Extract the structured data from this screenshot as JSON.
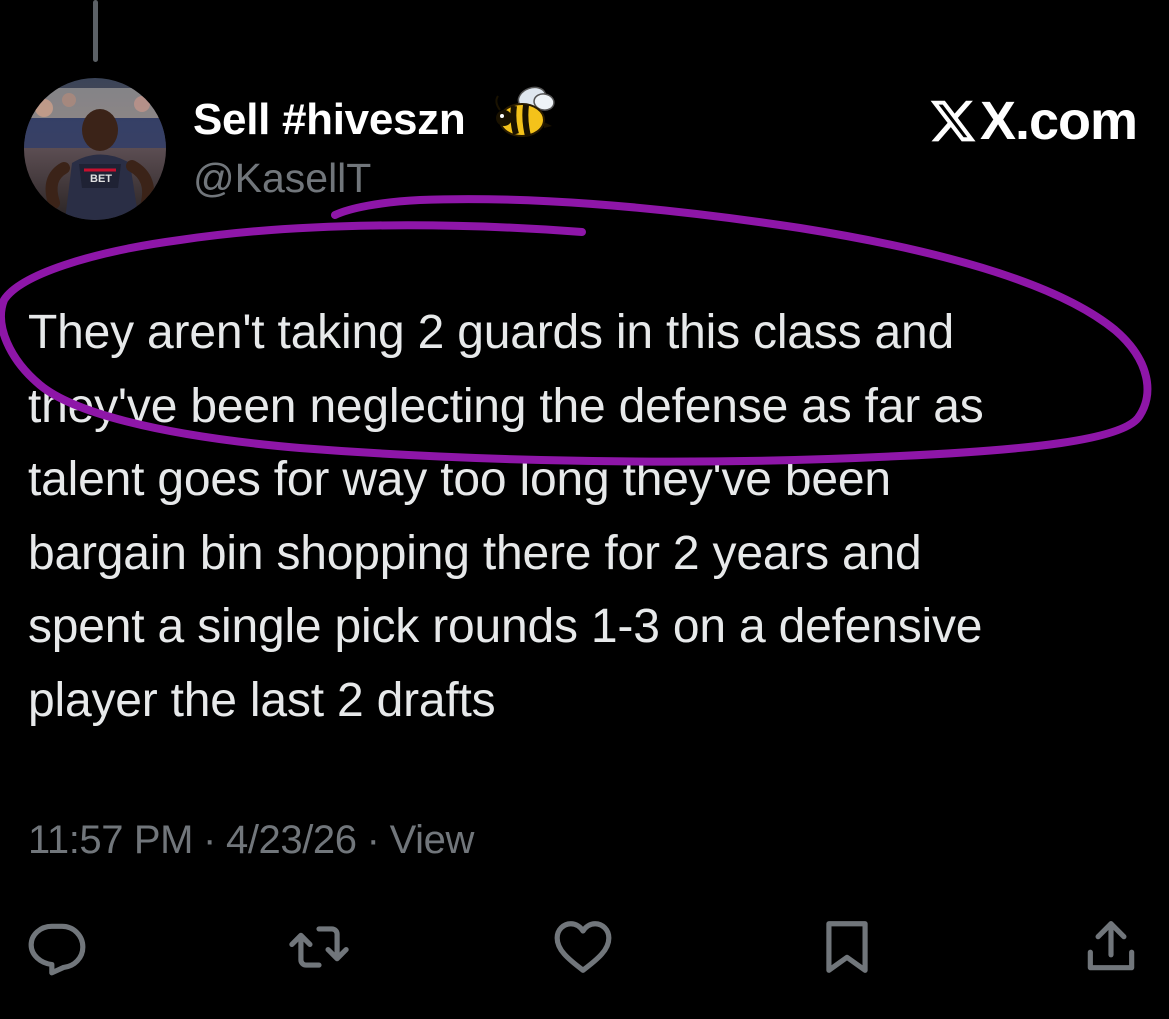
{
  "header": {
    "display_name": "Sell #hiveszn",
    "emoji_icon": "bee-icon",
    "handle": "@KasellT",
    "watermark": "X.com"
  },
  "tweet": {
    "text": "They aren't taking 2 guards in this class and\nthey've been neglecting the defense as far as\ntalent goes for way too long they've been\nbargain bin shopping there for 2 years and\nspent a single pick rounds 1-3  on a defensive\nplayer the last 2 drafts"
  },
  "meta": {
    "time": "11:57 PM",
    "separator": "·",
    "date": "4/23/26",
    "views_label": "View"
  },
  "actions": [
    {
      "icon": "reply-icon"
    },
    {
      "icon": "retweet-icon"
    },
    {
      "icon": "like-icon"
    },
    {
      "icon": "bookmark-icon"
    },
    {
      "icon": "share-icon"
    }
  ],
  "colors": {
    "background": "#000000",
    "primary_text": "#e7e9ea",
    "secondary_text": "#71767b",
    "annotation": "#8e16a8"
  }
}
